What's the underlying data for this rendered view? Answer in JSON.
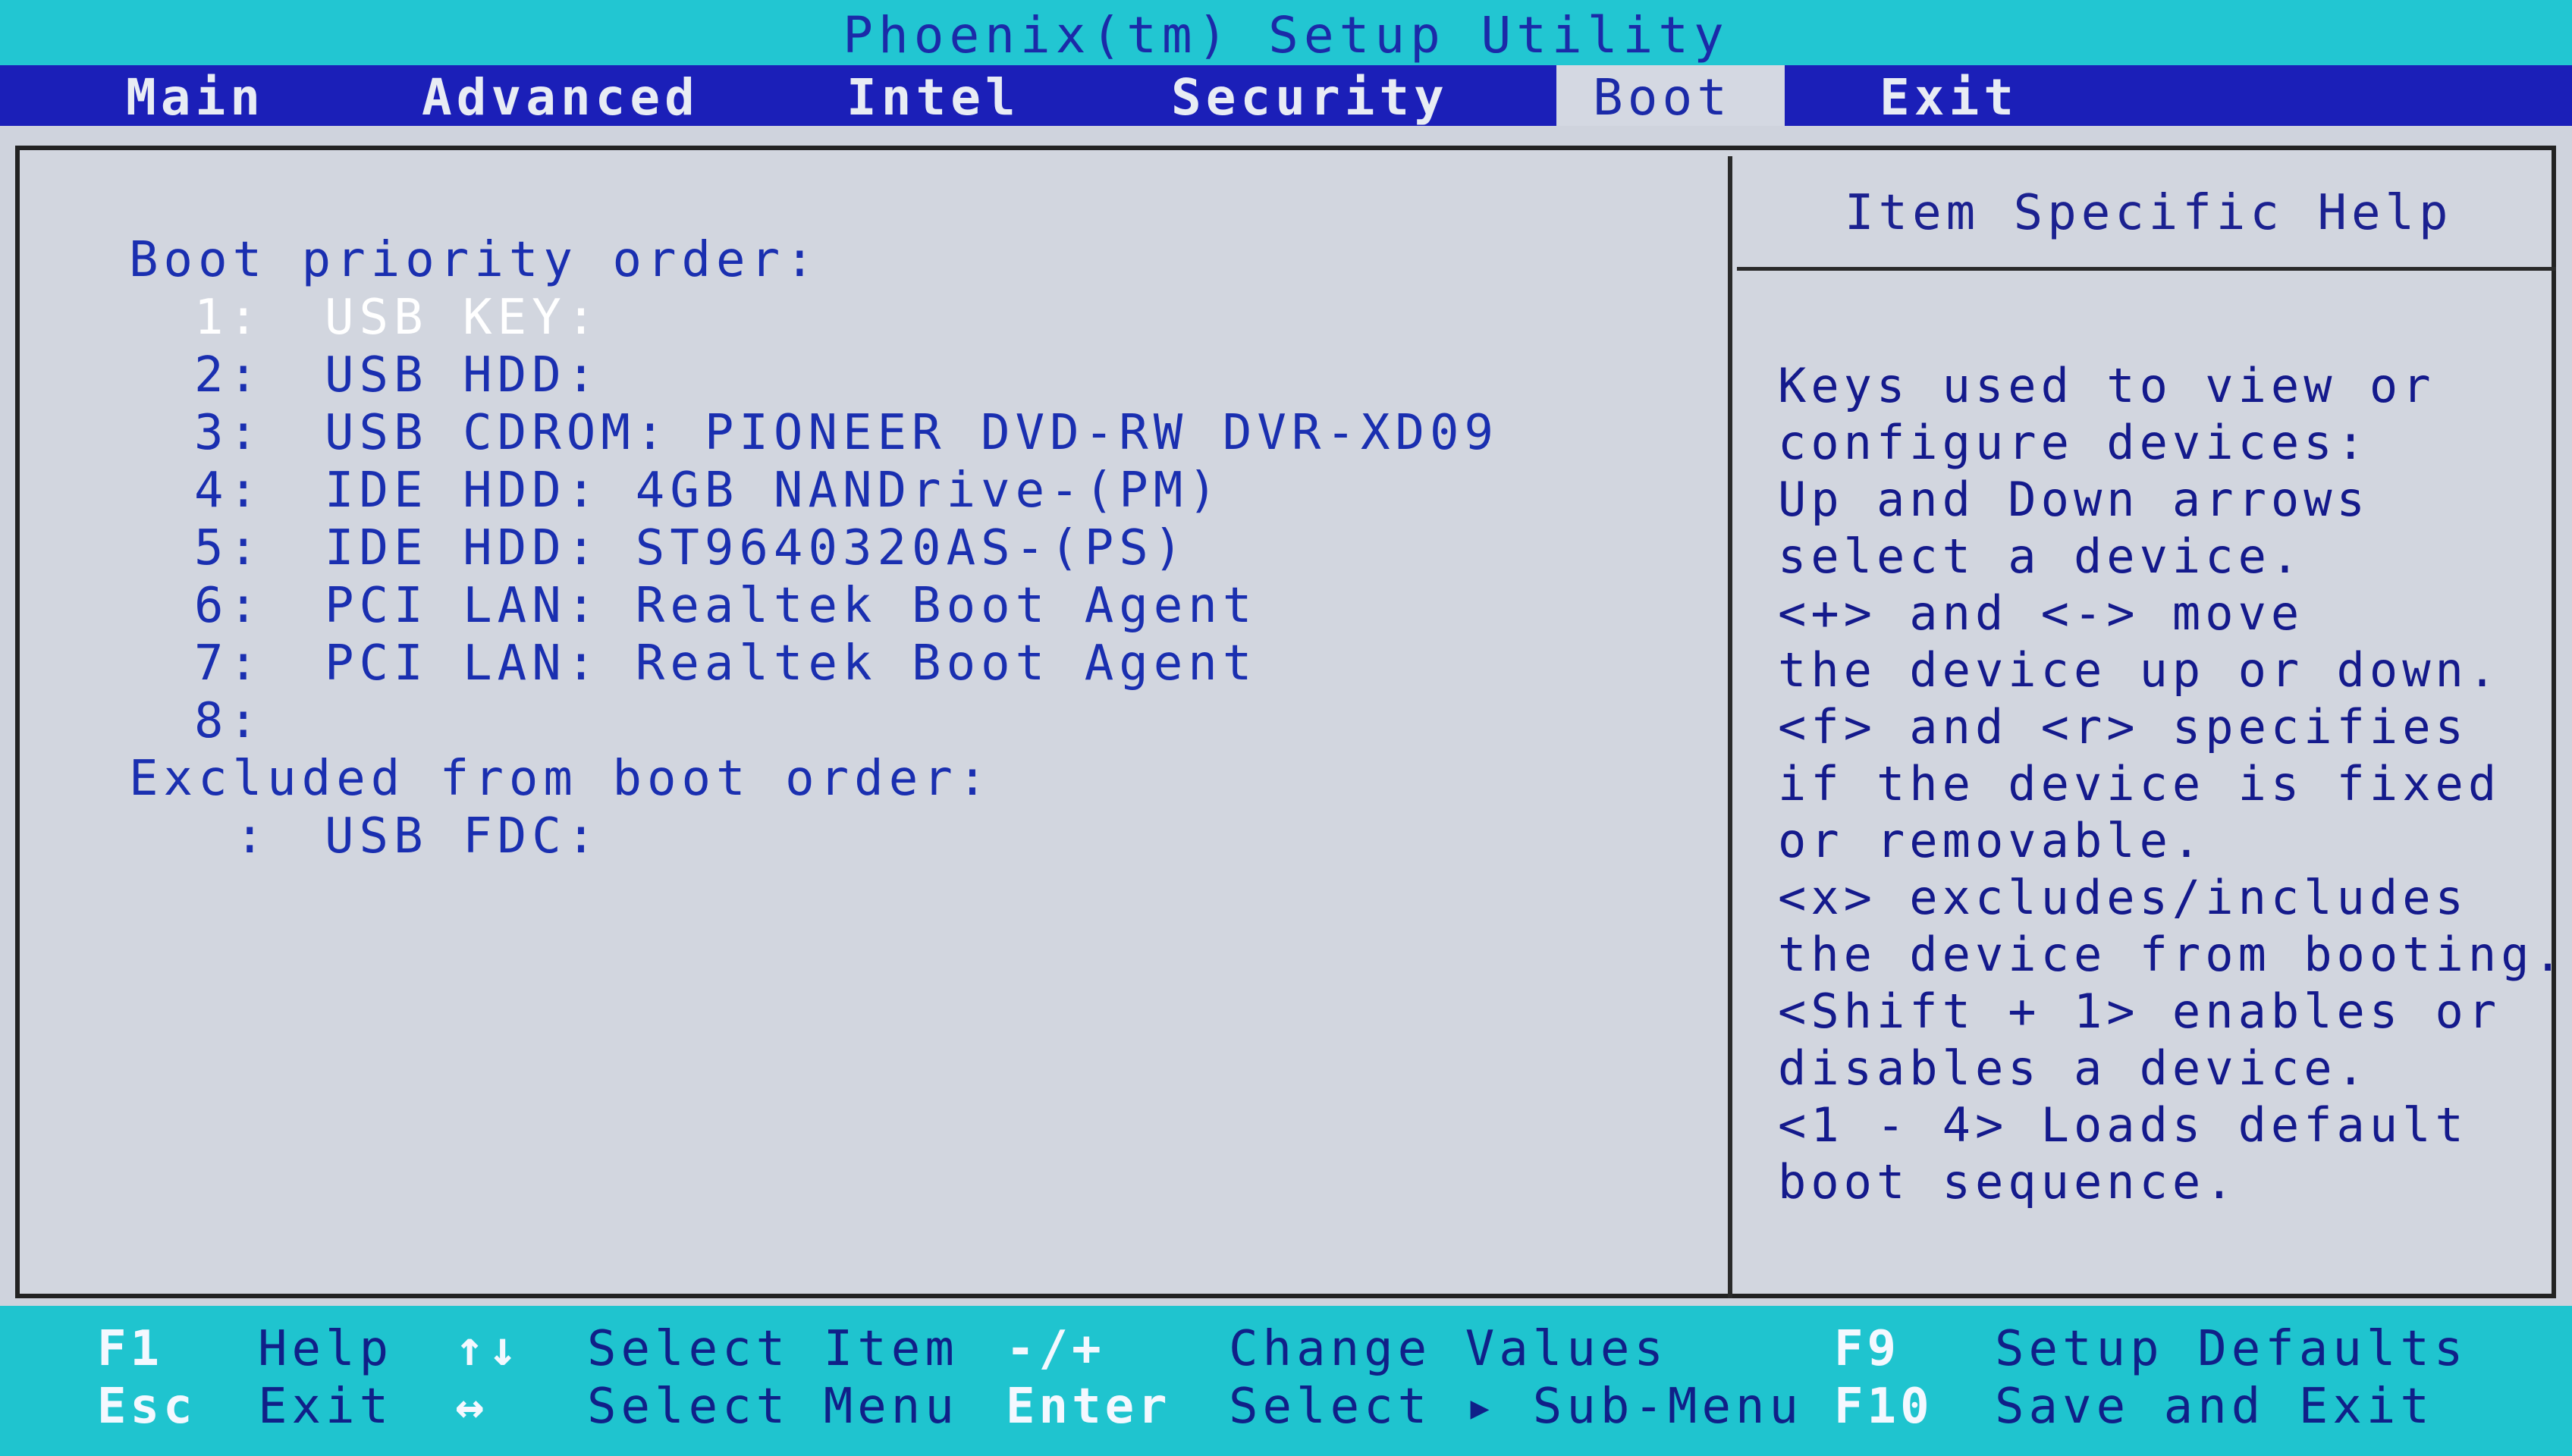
{
  "title": "Phoenix(tm) Setup Utility",
  "menu": {
    "tabs": [
      "Main",
      "Advanced",
      "Intel",
      "Security",
      "Boot",
      "Exit"
    ],
    "active": "Boot"
  },
  "boot": {
    "priority_header": "Boot priority order:",
    "items": [
      {
        "num": "1:",
        "device": "USB KEY:"
      },
      {
        "num": "2:",
        "device": "USB HDD:"
      },
      {
        "num": "3:",
        "device": "USB CDROM: PIONEER DVD-RW DVR-XD09"
      },
      {
        "num": "4:",
        "device": "IDE HDD: 4GB NANDrive-(PM)"
      },
      {
        "num": "5:",
        "device": "IDE HDD: ST9640320AS-(PS)"
      },
      {
        "num": "6:",
        "device": "PCI LAN: Realtek Boot Agent"
      },
      {
        "num": "7:",
        "device": "PCI LAN: Realtek Boot Agent"
      },
      {
        "num": "8:",
        "device": ""
      }
    ],
    "excluded_header": "Excluded from boot order:",
    "excluded_items": [
      {
        "num": ":",
        "device": "USB FDC:"
      }
    ]
  },
  "help": {
    "title": "Item Specific Help",
    "lines": [
      "Keys used to view or",
      "configure devices:",
      "Up and Down arrows",
      "select a device.",
      "<+> and <-> move",
      "the device up or down.",
      "<f> and <r> specifies",
      "if the device is fixed",
      "or removable.",
      "<x> excludes/includes",
      "the device from booting.",
      "<Shift + 1> enables or",
      "disables a device.",
      "<1 - 4> Loads default",
      "boot sequence."
    ]
  },
  "status": {
    "row1": [
      {
        "key": "F1",
        "desc": "Help"
      },
      {
        "key": "↑↓",
        "desc": "Select Item"
      },
      {
        "key": "-/+",
        "desc": "Change Values"
      },
      {
        "key": "F9",
        "desc": "Setup Defaults"
      }
    ],
    "row2": [
      {
        "key": "Esc",
        "desc": "Exit"
      },
      {
        "key": "↔",
        "desc": "Select Menu"
      },
      {
        "key": "Enter",
        "desc": "Select ▸ Sub-Menu"
      },
      {
        "key": "F10",
        "desc": "Save and Exit"
      }
    ]
  },
  "colors": {
    "title_bar": "#22c6d2",
    "menu_bar": "#1b1fb8",
    "panel": "#d2d6df",
    "text_blue": "#1a2fb0",
    "selected_text": "#ffffff"
  }
}
